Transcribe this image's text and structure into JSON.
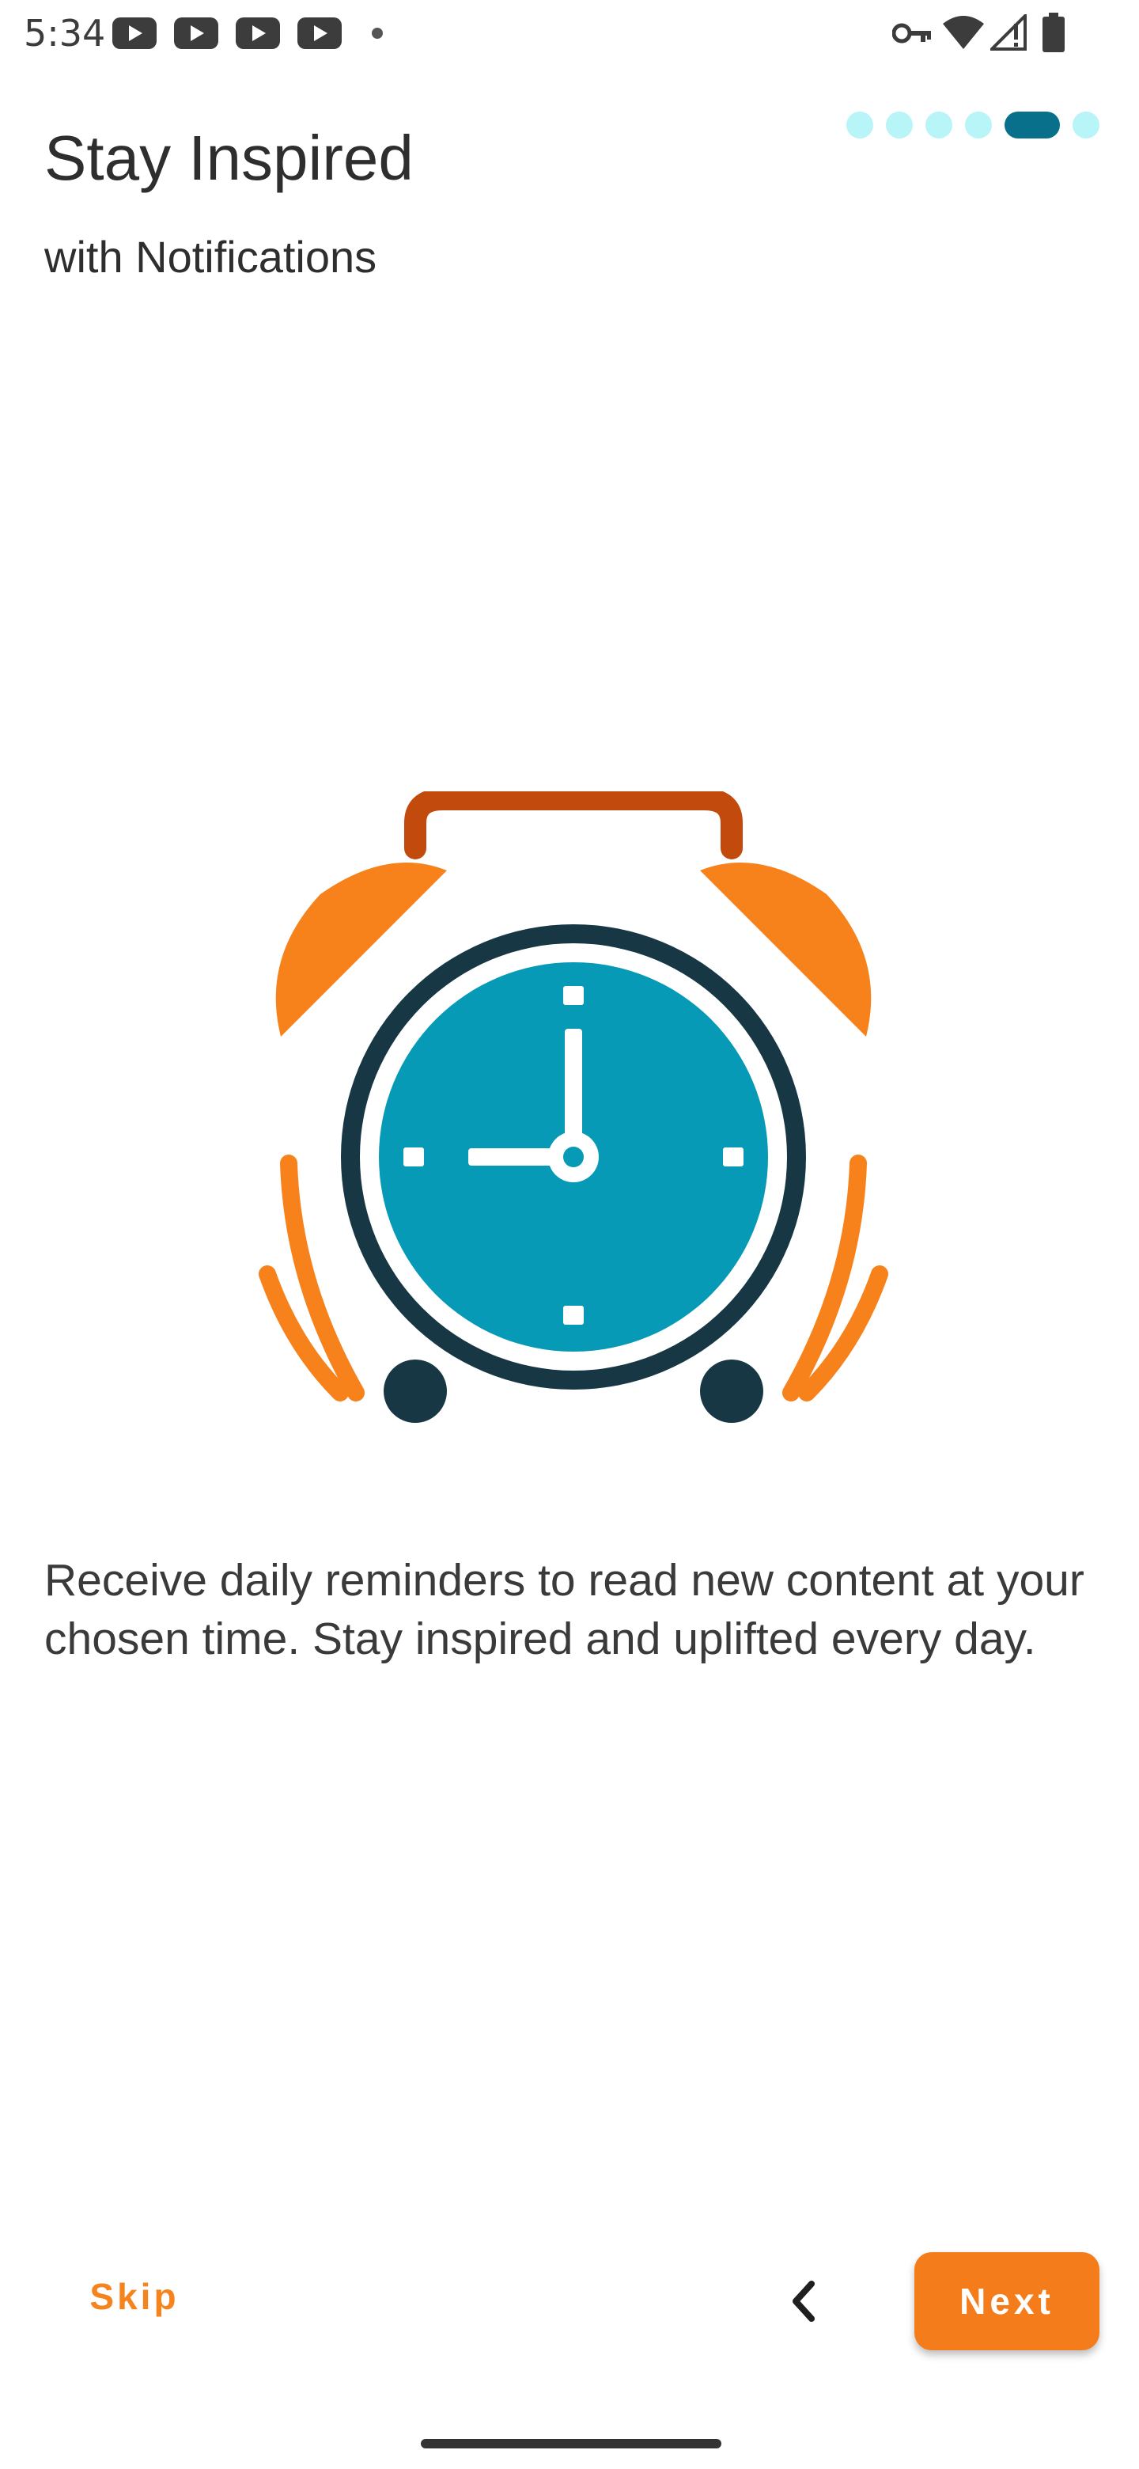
{
  "status_bar": {
    "time": "5:34",
    "notification_icons": [
      "youtube-icon",
      "youtube-icon",
      "youtube-icon",
      "youtube-icon"
    ],
    "right_icons": [
      "vpn-key-icon",
      "wifi-icon",
      "signal-icon",
      "battery-icon"
    ]
  },
  "header": {
    "title": "Stay Inspired",
    "subtitle": "with Notifications"
  },
  "pager": {
    "total": 6,
    "active_index": 4
  },
  "illustration": {
    "icon": "alarm-clock-icon",
    "colors": {
      "bells": "#f7821b",
      "handle": "#c24a0c",
      "rim": "#173744",
      "face": "#069ab6",
      "hands": "#ffffff"
    }
  },
  "description": "Receive daily reminders to read new content at your chosen time. Stay inspired and uplifted every day.",
  "nav": {
    "skip_label": "Skip",
    "next_label": "Next",
    "back_icon": "chevron-left-icon"
  },
  "colors": {
    "accent": "#f57c1b",
    "pager_active": "#08708a",
    "pager_inactive": "#b8f5f8"
  }
}
